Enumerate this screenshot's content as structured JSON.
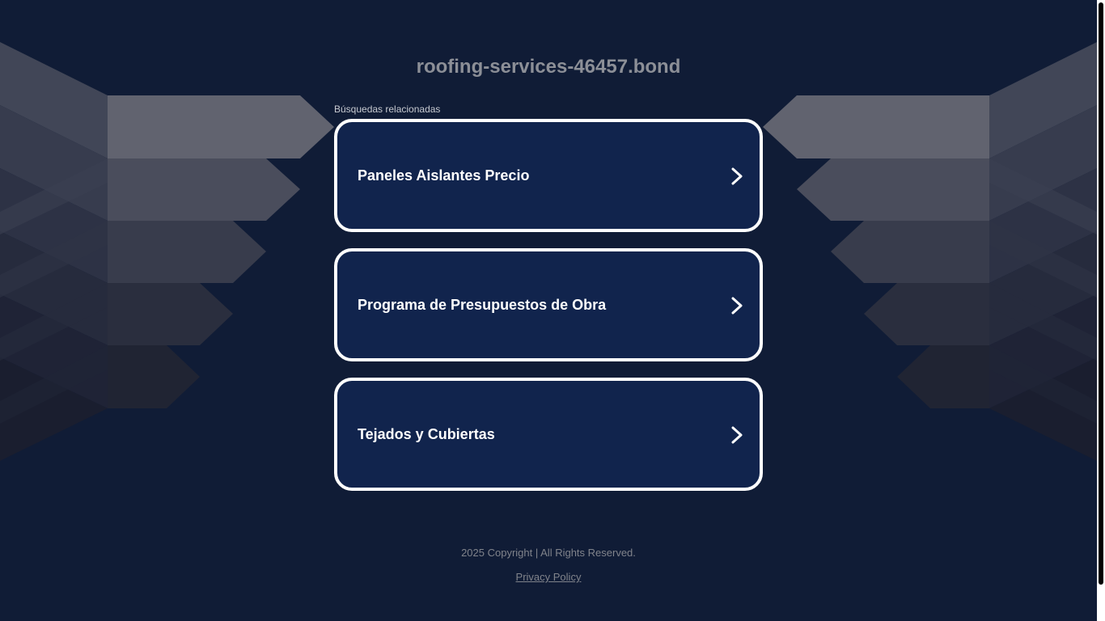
{
  "site": {
    "domain_title": "roofing-services-46457.bond"
  },
  "related": {
    "label": "Búsquedas relacionadas",
    "items": [
      {
        "label": "Paneles Aislantes Precio",
        "icon": "chevron-right-icon"
      },
      {
        "label": "Programa de Presupuestos de Obra",
        "icon": "chevron-right-icon"
      },
      {
        "label": "Tejados y Cubiertas",
        "icon": "chevron-right-icon"
      }
    ]
  },
  "footer": {
    "copyright": "2025 Copyright | All Rights Reserved.",
    "privacy_link": "Privacy Policy"
  },
  "colors": {
    "background": "#101c36",
    "card_background": "#11244d",
    "card_border": "#ffffff",
    "title_text": "#8c8f97",
    "footer_text": "#80838b"
  }
}
